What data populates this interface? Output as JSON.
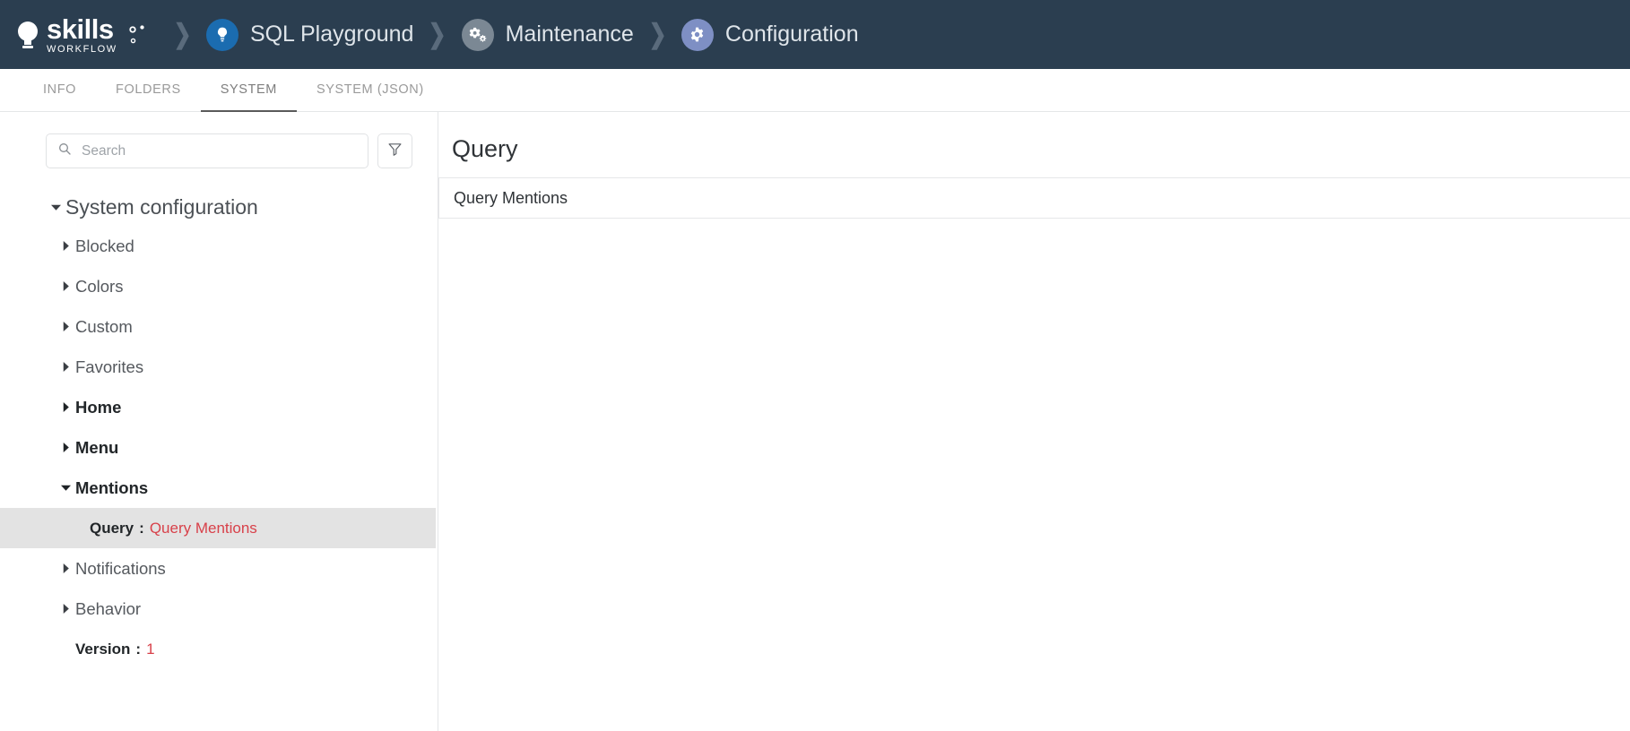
{
  "header": {
    "brand": {
      "name": "skills",
      "subtitle": "WORKFLOW",
      "logo_icon": "lightbulb-icon",
      "gears_icon": "gears-icon"
    },
    "separator": "❯",
    "breadcrumbs": [
      {
        "label": "SQL Playground",
        "icon": "lightbulb-circle-icon",
        "icon_bg": "#1b6cb0"
      },
      {
        "label": "Maintenance",
        "icon": "gears-circle-icon",
        "icon_bg": "#7b8894"
      },
      {
        "label": "Configuration",
        "icon": "gear-circle-icon",
        "icon_bg": "#7e8fc4"
      }
    ],
    "background": "#2b3e50",
    "text_color": "#dfe5ea"
  },
  "tabs": [
    {
      "label": "INFO",
      "active": false
    },
    {
      "label": "FOLDERS",
      "active": false
    },
    {
      "label": "SYSTEM",
      "active": true
    },
    {
      "label": "SYSTEM (JSON)",
      "active": false
    }
  ],
  "search": {
    "placeholder": "Search",
    "value": "",
    "icon": "search-icon",
    "filter_icon": "funnel-icon"
  },
  "tree": {
    "root": {
      "label": "System configuration",
      "expanded": true
    },
    "items": [
      {
        "label": "Blocked",
        "expanded": false,
        "modified": false
      },
      {
        "label": "Colors",
        "expanded": false,
        "modified": false
      },
      {
        "label": "Custom",
        "expanded": false,
        "modified": false
      },
      {
        "label": "Favorites",
        "expanded": false,
        "modified": false
      },
      {
        "label": "Home",
        "expanded": false,
        "modified": true
      },
      {
        "label": "Menu",
        "expanded": false,
        "modified": true
      },
      {
        "label": "Mentions",
        "expanded": true,
        "modified": true
      }
    ],
    "selected_leaf": {
      "key": "Query",
      "separator": ":",
      "value": "Query Mentions"
    },
    "items_after": [
      {
        "label": "Notifications",
        "expanded": false,
        "modified": false
      },
      {
        "label": "Behavior",
        "expanded": false,
        "modified": false
      }
    ],
    "version": {
      "key": "Version",
      "separator": ":",
      "value": "1"
    },
    "value_color": "#d8414a",
    "selected_bg": "#e3e3e3"
  },
  "detail": {
    "title": "Query",
    "field_value": "Query Mentions"
  }
}
